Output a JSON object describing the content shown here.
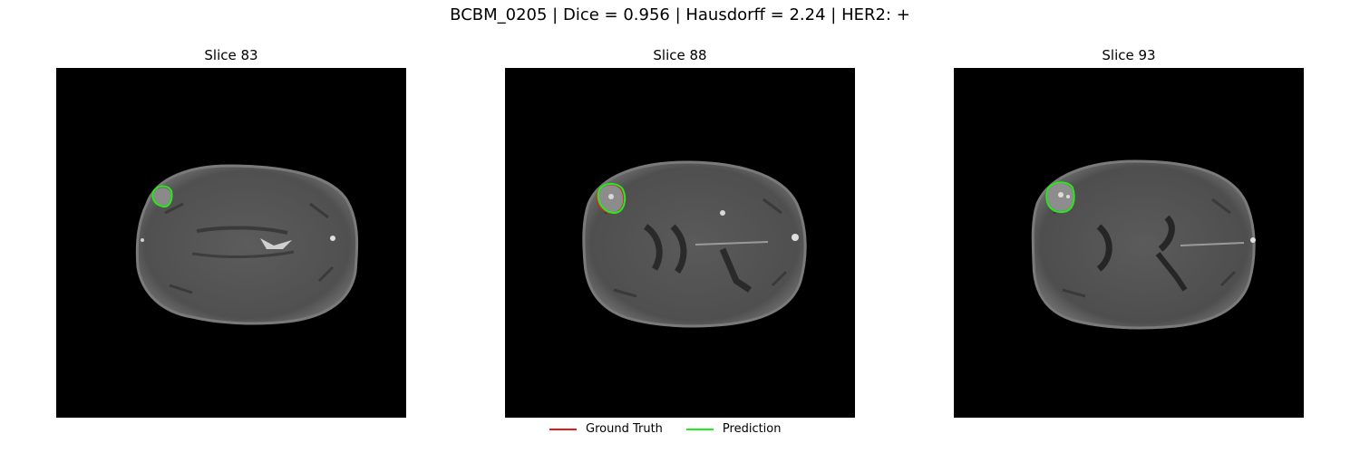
{
  "figure": {
    "title": "BCBM_0205 | Dice = 0.956 | Hausdorff = 2.24 | HER2: +"
  },
  "panels": [
    {
      "title": "Slice 83"
    },
    {
      "title": "Slice 88"
    },
    {
      "title": "Slice 93"
    }
  ],
  "legend": {
    "items": [
      {
        "label": "Ground Truth",
        "color": "#e8191b"
      },
      {
        "label": "Prediction",
        "color": "#1fee1f"
      }
    ]
  },
  "colors": {
    "background": "#000000",
    "brain_tissue": "#5a5a5a",
    "ground_truth": "#e8191b",
    "prediction": "#1fee1f"
  }
}
